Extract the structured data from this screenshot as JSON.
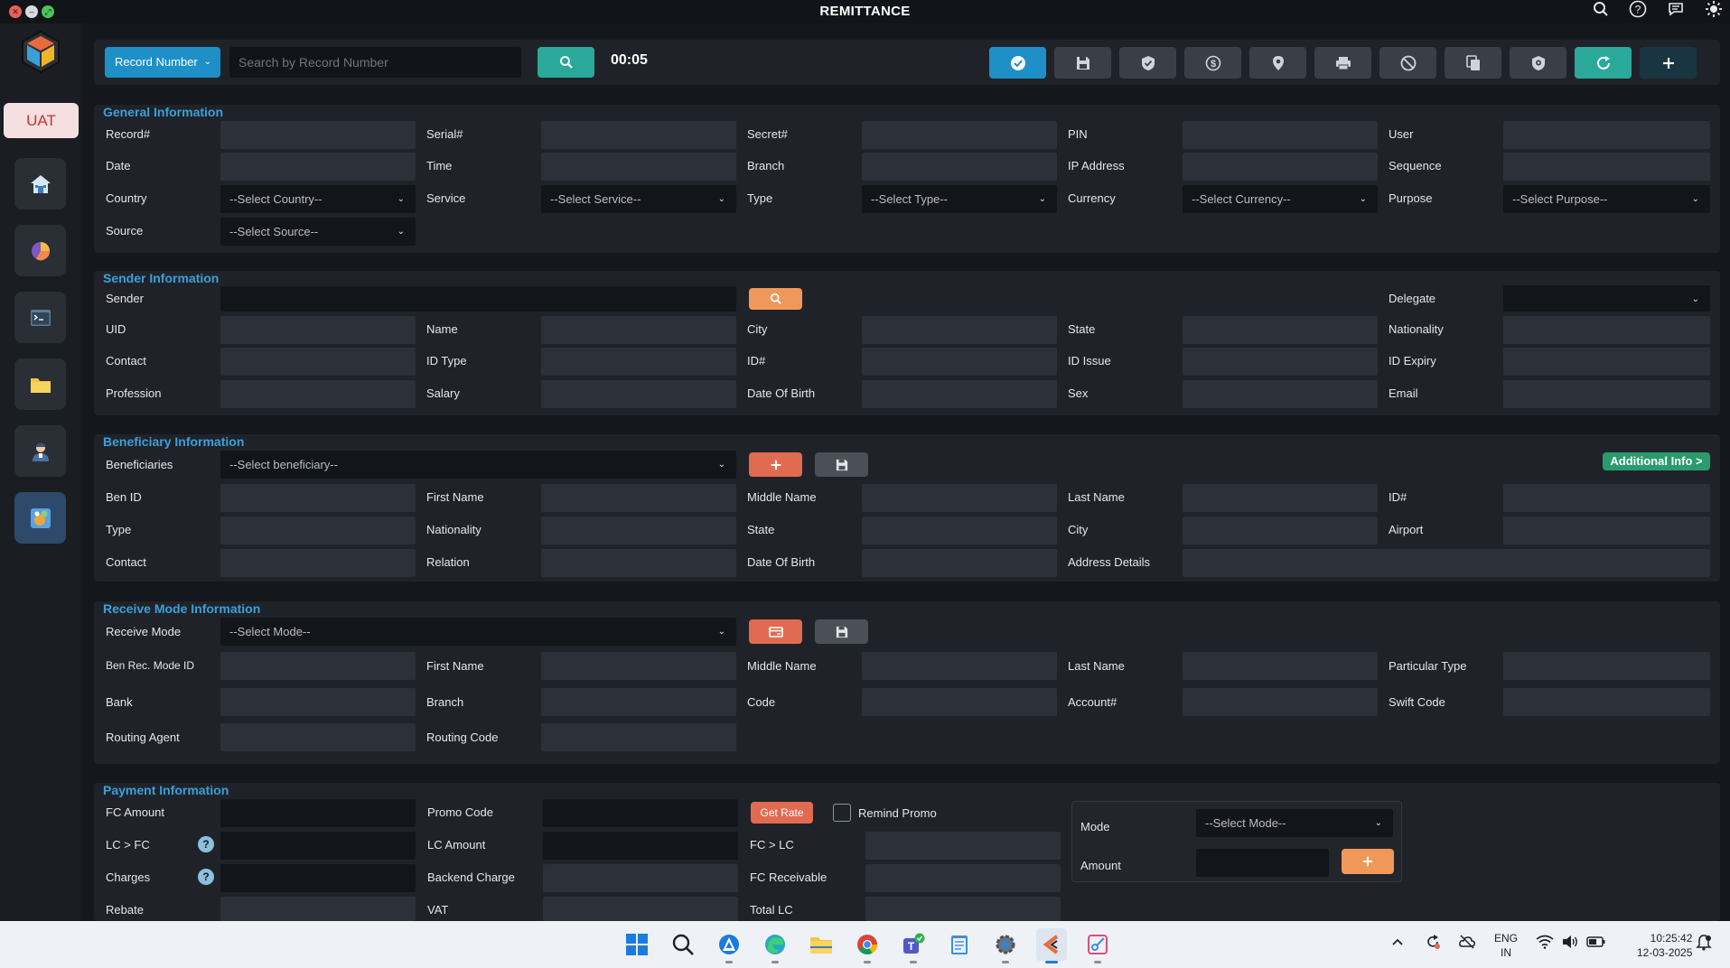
{
  "window": {
    "title": "REMITTANCE"
  },
  "sidebar": {
    "env_badge": "UAT",
    "items": [
      "home-icon",
      "chart-icon",
      "terminal-icon",
      "folder-icon",
      "user-icon",
      "analytics-icon"
    ]
  },
  "toolbar": {
    "search_type": "Record Number",
    "search_placeholder": "Search by Record Number",
    "timer": "00:05",
    "actions": [
      "check-icon",
      "save-icon",
      "shield-check-icon",
      "dollar-icon",
      "location-icon",
      "print-icon",
      "cancel-icon",
      "copy-icon",
      "shield-lock-icon",
      "refresh-icon",
      "plus-icon"
    ]
  },
  "general": {
    "title": "General Information",
    "labels": {
      "record": "Record#",
      "serial": "Serial#",
      "secret": "Secret#",
      "pin": "PIN",
      "user": "User",
      "date": "Date",
      "time": "Time",
      "branch": "Branch",
      "ip": "IP Address",
      "sequence": "Sequence",
      "country": "Country",
      "service": "Service",
      "type": "Type",
      "currency": "Currency",
      "purpose": "Purpose",
      "source": "Source"
    },
    "selects": {
      "country": "--Select Country--",
      "service": "--Select Service--",
      "type": "--Select Type--",
      "currency": "--Select Currency--",
      "purpose": "--Select Purpose--",
      "source": "--Select Source--"
    }
  },
  "sender": {
    "title": "Sender Information",
    "labels": {
      "sender": "Sender",
      "delegate": "Delegate",
      "uid": "UID",
      "name": "Name",
      "city": "City",
      "state": "State",
      "nationality": "Nationality",
      "contact": "Contact",
      "id_type": "ID Type",
      "id_no": "ID#",
      "id_issue": "ID Issue",
      "id_expiry": "ID Expiry",
      "profession": "Profession",
      "salary": "Salary",
      "dob": "Date Of Birth",
      "sex": "Sex",
      "email": "Email"
    }
  },
  "beneficiary": {
    "title": "Beneficiary Information",
    "additional": "Additional Info >",
    "select": "--Select beneficiary--",
    "labels": {
      "beneficiaries": "Beneficiaries",
      "ben_id": "Ben ID",
      "first": "First Name",
      "middle": "Middle Name",
      "last": "Last Name",
      "id_no": "ID#",
      "type": "Type",
      "nationality": "Nationality",
      "state": "State",
      "city": "City",
      "airport": "Airport",
      "contact": "Contact",
      "relation": "Relation",
      "dob": "Date Of Birth",
      "address": "Address Details"
    }
  },
  "receive": {
    "title": "Receive Mode Information",
    "select": "--Select Mode--",
    "labels": {
      "mode": "Receive Mode",
      "ben_rec": "Ben Rec. Mode ID",
      "first": "First Name",
      "middle": "Middle Name",
      "last": "Last Name",
      "particular": "Particular Type",
      "bank": "Bank",
      "branch": "Branch",
      "code": "Code",
      "account": "Account#",
      "swift": "Swift Code",
      "routing_agent": "Routing Agent",
      "routing_code": "Routing Code"
    }
  },
  "payment": {
    "title": "Payment Information",
    "get_rate": "Get Rate",
    "remind": "Remind Promo",
    "mode_select": "--Select Mode--",
    "labels": {
      "fc_amount": "FC Amount",
      "promo": "Promo Code",
      "lc_fc": "LC > FC",
      "lc_amount": "LC Amount",
      "fc_lc": "FC > LC",
      "charges": "Charges",
      "backend": "Backend Charge",
      "fc_receivable": "FC Receivable",
      "rebate": "Rebate",
      "vat": "VAT",
      "total_lc": "Total LC",
      "mode": "Mode",
      "amount": "Amount"
    }
  },
  "taskbar": {
    "apps": [
      "windows-icon",
      "search-icon",
      "store-icon",
      "edge-icon",
      "explorer-icon",
      "chrome-icon",
      "teams-icon",
      "notepad-icon",
      "settings-icon",
      "app-icon",
      "snip-icon"
    ],
    "lang1": "ENG",
    "lang2": "IN",
    "time": "10:25:42",
    "date": "12-03-2025"
  }
}
